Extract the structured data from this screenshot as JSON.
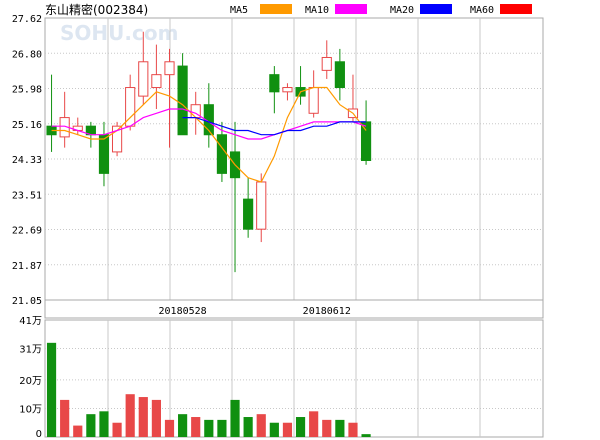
{
  "title": "东山精密(002384)",
  "watermark": "SOHU.com",
  "colors": {
    "up": "#e84848",
    "down": "#109010",
    "grid": "#c8c8c8",
    "frame": "#a8a8a8"
  },
  "chart_data": [
    {
      "type": "candlestick",
      "legend": [
        {
          "name": "MA5",
          "color": "#ff9a00"
        },
        {
          "name": "MA10",
          "color": "#ff00ff"
        },
        {
          "name": "MA20",
          "color": "#0000ff"
        },
        {
          "name": "MA60",
          "color": "#ff0000"
        }
      ],
      "ylim": [
        21.05,
        27.62
      ],
      "yticks": [
        "27.62",
        "26.80",
        "25.98",
        "25.16",
        "24.33",
        "23.51",
        "22.69",
        "21.87",
        "21.05"
      ],
      "xticks": [
        {
          "index": 10,
          "label": "20180528"
        },
        {
          "index": 21,
          "label": "20180612"
        }
      ],
      "grid": true,
      "candles": [
        {
          "o": 25.1,
          "h": 26.3,
          "l": 24.5,
          "c": 24.9
        },
        {
          "o": 24.85,
          "h": 25.9,
          "l": 24.6,
          "c": 25.3
        },
        {
          "o": 25.0,
          "h": 25.3,
          "l": 24.9,
          "c": 25.1
        },
        {
          "o": 25.1,
          "h": 25.2,
          "l": 24.6,
          "c": 24.9
        },
        {
          "o": 24.9,
          "h": 25.2,
          "l": 23.7,
          "c": 24.0
        },
        {
          "o": 24.5,
          "h": 25.2,
          "l": 24.4,
          "c": 25.1
        },
        {
          "o": 25.1,
          "h": 26.3,
          "l": 25.0,
          "c": 26.0
        },
        {
          "o": 25.8,
          "h": 27.3,
          "l": 25.6,
          "c": 26.6
        },
        {
          "o": 26.0,
          "h": 27.0,
          "l": 25.5,
          "c": 26.3
        },
        {
          "o": 26.3,
          "h": 26.9,
          "l": 24.6,
          "c": 26.6
        },
        {
          "o": 26.5,
          "h": 26.8,
          "l": 24.9,
          "c": 24.9
        },
        {
          "o": 25.3,
          "h": 25.9,
          "l": 24.9,
          "c": 25.6
        },
        {
          "o": 25.6,
          "h": 26.1,
          "l": 24.6,
          "c": 24.9
        },
        {
          "o": 24.9,
          "h": 25.2,
          "l": 23.8,
          "c": 24.0
        },
        {
          "o": 24.5,
          "h": 25.2,
          "l": 21.7,
          "c": 23.9
        },
        {
          "o": 23.4,
          "h": 23.9,
          "l": 22.5,
          "c": 22.7
        },
        {
          "o": 22.7,
          "h": 24.0,
          "l": 22.4,
          "c": 23.8
        },
        {
          "o": 26.3,
          "h": 26.5,
          "l": 25.4,
          "c": 25.9
        },
        {
          "o": 25.9,
          "h": 26.1,
          "l": 25.7,
          "c": 26.0
        },
        {
          "o": 26.0,
          "h": 26.5,
          "l": 25.6,
          "c": 25.8
        },
        {
          "o": 25.4,
          "h": 26.4,
          "l": 25.3,
          "c": 26.0
        },
        {
          "o": 26.4,
          "h": 27.1,
          "l": 26.2,
          "c": 26.7
        },
        {
          "o": 26.6,
          "h": 26.9,
          "l": 25.7,
          "c": 26.0
        },
        {
          "o": 25.3,
          "h": 26.3,
          "l": 25.2,
          "c": 25.5
        },
        {
          "o": 25.2,
          "h": 25.7,
          "l": 24.2,
          "c": 24.3
        }
      ],
      "ma5": [
        25.0,
        25.0,
        24.9,
        24.8,
        24.8,
        25.0,
        25.3,
        25.6,
        25.9,
        25.8,
        25.6,
        25.3,
        25.0,
        24.6,
        24.2,
        23.9,
        23.8,
        24.4,
        25.3,
        25.9,
        26.0,
        26.0,
        25.6,
        25.4,
        25.0
      ],
      "ma10": [
        25.1,
        25.1,
        25.0,
        24.9,
        24.9,
        25.0,
        25.1,
        25.3,
        25.4,
        25.5,
        25.5,
        25.4,
        25.2,
        25.0,
        24.9,
        24.8,
        24.8,
        24.9,
        25.0,
        25.1,
        25.2,
        25.2,
        25.2,
        25.2,
        25.1
      ],
      "ma20": [
        null,
        null,
        null,
        null,
        null,
        null,
        null,
        null,
        null,
        null,
        25.3,
        25.3,
        25.2,
        25.1,
        25.0,
        25.0,
        24.9,
        24.9,
        25.0,
        25.0,
        25.1,
        25.1,
        25.2,
        25.2,
        25.2
      ]
    },
    {
      "type": "bar",
      "unit_label_top": "41万",
      "ylim": [
        0,
        41
      ],
      "yticks": [
        {
          "value": 31,
          "label": "31万"
        },
        {
          "value": 20,
          "label": "20万"
        },
        {
          "value": 10,
          "label": "10万"
        },
        {
          "value": 0,
          "label": "0"
        }
      ],
      "values": [
        33,
        13,
        4,
        8,
        9,
        5,
        15,
        14,
        13,
        6,
        8,
        7,
        6,
        6,
        13,
        7,
        8,
        5,
        5,
        7,
        9,
        6,
        6,
        5,
        1
      ]
    }
  ]
}
